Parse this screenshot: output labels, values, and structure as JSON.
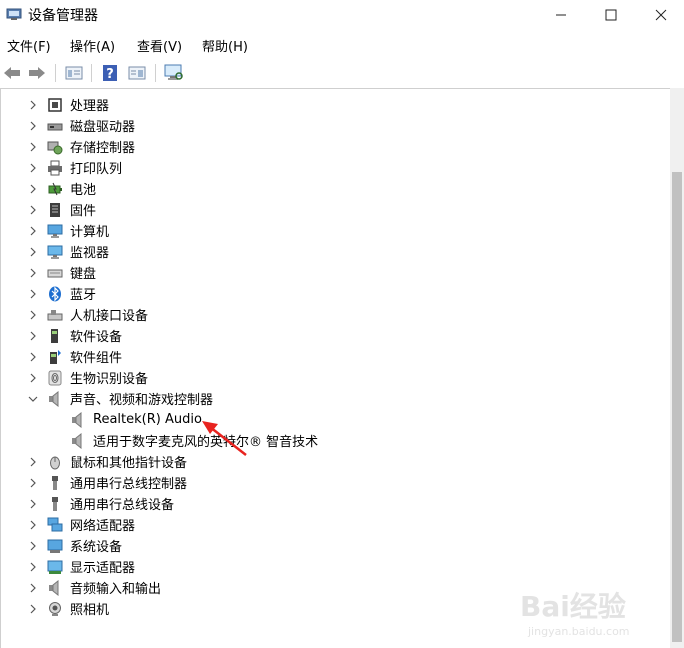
{
  "window": {
    "title": "设备管理器",
    "minimize_icon": "minimize-icon",
    "maximize_icon": "maximize-icon",
    "close_icon": "close-icon"
  },
  "menu": [
    "文件(F)",
    "操作(A)",
    "查看(V)",
    "帮助(H)"
  ],
  "toolbar": [
    "back-icon",
    "forward-icon",
    "properties-icon",
    "help-icon",
    "view-icon",
    "scan-monitor-icon"
  ],
  "tree": {
    "items": [
      {
        "label": "处理器",
        "icon": "processor-icon",
        "expanded": false
      },
      {
        "label": "磁盘驱动器",
        "icon": "disk-drive-icon",
        "expanded": false
      },
      {
        "label": "存储控制器",
        "icon": "storage-controller-icon",
        "expanded": false
      },
      {
        "label": "打印队列",
        "icon": "printer-icon",
        "expanded": false
      },
      {
        "label": "电池",
        "icon": "battery-icon",
        "expanded": false
      },
      {
        "label": "固件",
        "icon": "firmware-icon",
        "expanded": false
      },
      {
        "label": "计算机",
        "icon": "computer-icon",
        "expanded": false
      },
      {
        "label": "监视器",
        "icon": "monitor-icon",
        "expanded": false
      },
      {
        "label": "键盘",
        "icon": "keyboard-icon",
        "expanded": false
      },
      {
        "label": "蓝牙",
        "icon": "bluetooth-icon",
        "expanded": false
      },
      {
        "label": "人机接口设备",
        "icon": "hid-icon",
        "expanded": false
      },
      {
        "label": "软件设备",
        "icon": "software-device-icon",
        "expanded": false
      },
      {
        "label": "软件组件",
        "icon": "software-component-icon",
        "expanded": false
      },
      {
        "label": "生物识别设备",
        "icon": "fingerprint-icon",
        "expanded": false
      },
      {
        "label": "声音、视频和游戏控制器",
        "icon": "speaker-icon",
        "expanded": true,
        "children": [
          {
            "label": "Realtek(R) Audio",
            "icon": "speaker-icon"
          },
          {
            "label": "适用于数字麦克风的英特尔® 智音技术",
            "icon": "speaker-icon"
          }
        ]
      },
      {
        "label": "鼠标和其他指针设备",
        "icon": "mouse-icon",
        "expanded": false
      },
      {
        "label": "通用串行总线控制器",
        "icon": "usb-icon",
        "expanded": false
      },
      {
        "label": "通用串行总线设备",
        "icon": "usb-icon",
        "expanded": false
      },
      {
        "label": "网络适配器",
        "icon": "network-icon",
        "expanded": false
      },
      {
        "label": "系统设备",
        "icon": "system-device-icon",
        "expanded": false
      },
      {
        "label": "显示适配器",
        "icon": "display-adapter-icon",
        "expanded": false
      },
      {
        "label": "音频输入和输出",
        "icon": "audio-io-icon",
        "expanded": false
      },
      {
        "label": "照相机",
        "icon": "camera-icon",
        "expanded": false
      }
    ]
  },
  "annotation_color": "#e8231f",
  "watermark": {
    "main": "Bai经验",
    "sub": "jingyan.baidu.com"
  }
}
